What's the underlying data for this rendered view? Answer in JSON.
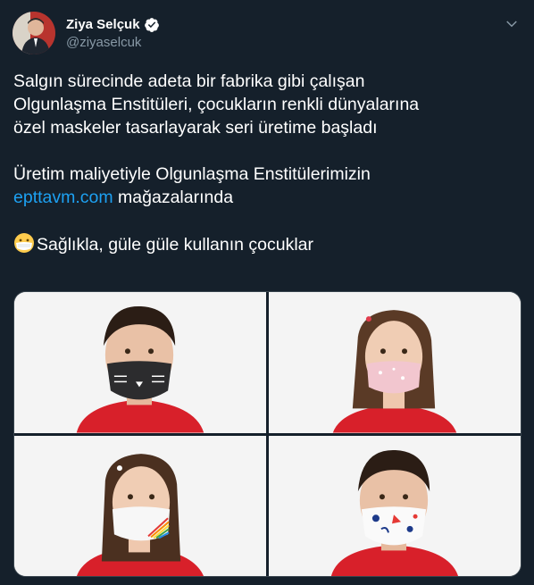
{
  "author": {
    "name": "Ziya Selçuk",
    "handle": "@ziyaselcuk",
    "verified": true
  },
  "tweet": {
    "line1": "Salgın sürecinde adeta bir fabrika gibi çalışan",
    "line2": "Olgunlaşma Enstitüleri, çocukların renkli dünyalarına",
    "line3": "özel maskeler tasarlayarak seri üretime başladı",
    "line4": "Üretim maliyetiyle Olgunlaşma Enstitülerimizin",
    "link_text": "epttavm.com",
    "line5_rest": " mağazalarında",
    "line6": "Sağlıkla, güle güle kullanın çocuklar",
    "emoji": "face-with-medical-mask"
  },
  "photos": [
    {
      "subject": "boy",
      "mask": "black cat mask"
    },
    {
      "subject": "girl",
      "mask": "pink patterned mask"
    },
    {
      "subject": "girl",
      "mask": "white rainbow mask"
    },
    {
      "subject": "boy",
      "mask": "white patterned mask"
    }
  ],
  "colors": {
    "background": "#15202b",
    "link": "#1da1f2",
    "verified": "#ffffff",
    "secondary_text": "#8899a6",
    "shirt_red": "#d8202a"
  }
}
